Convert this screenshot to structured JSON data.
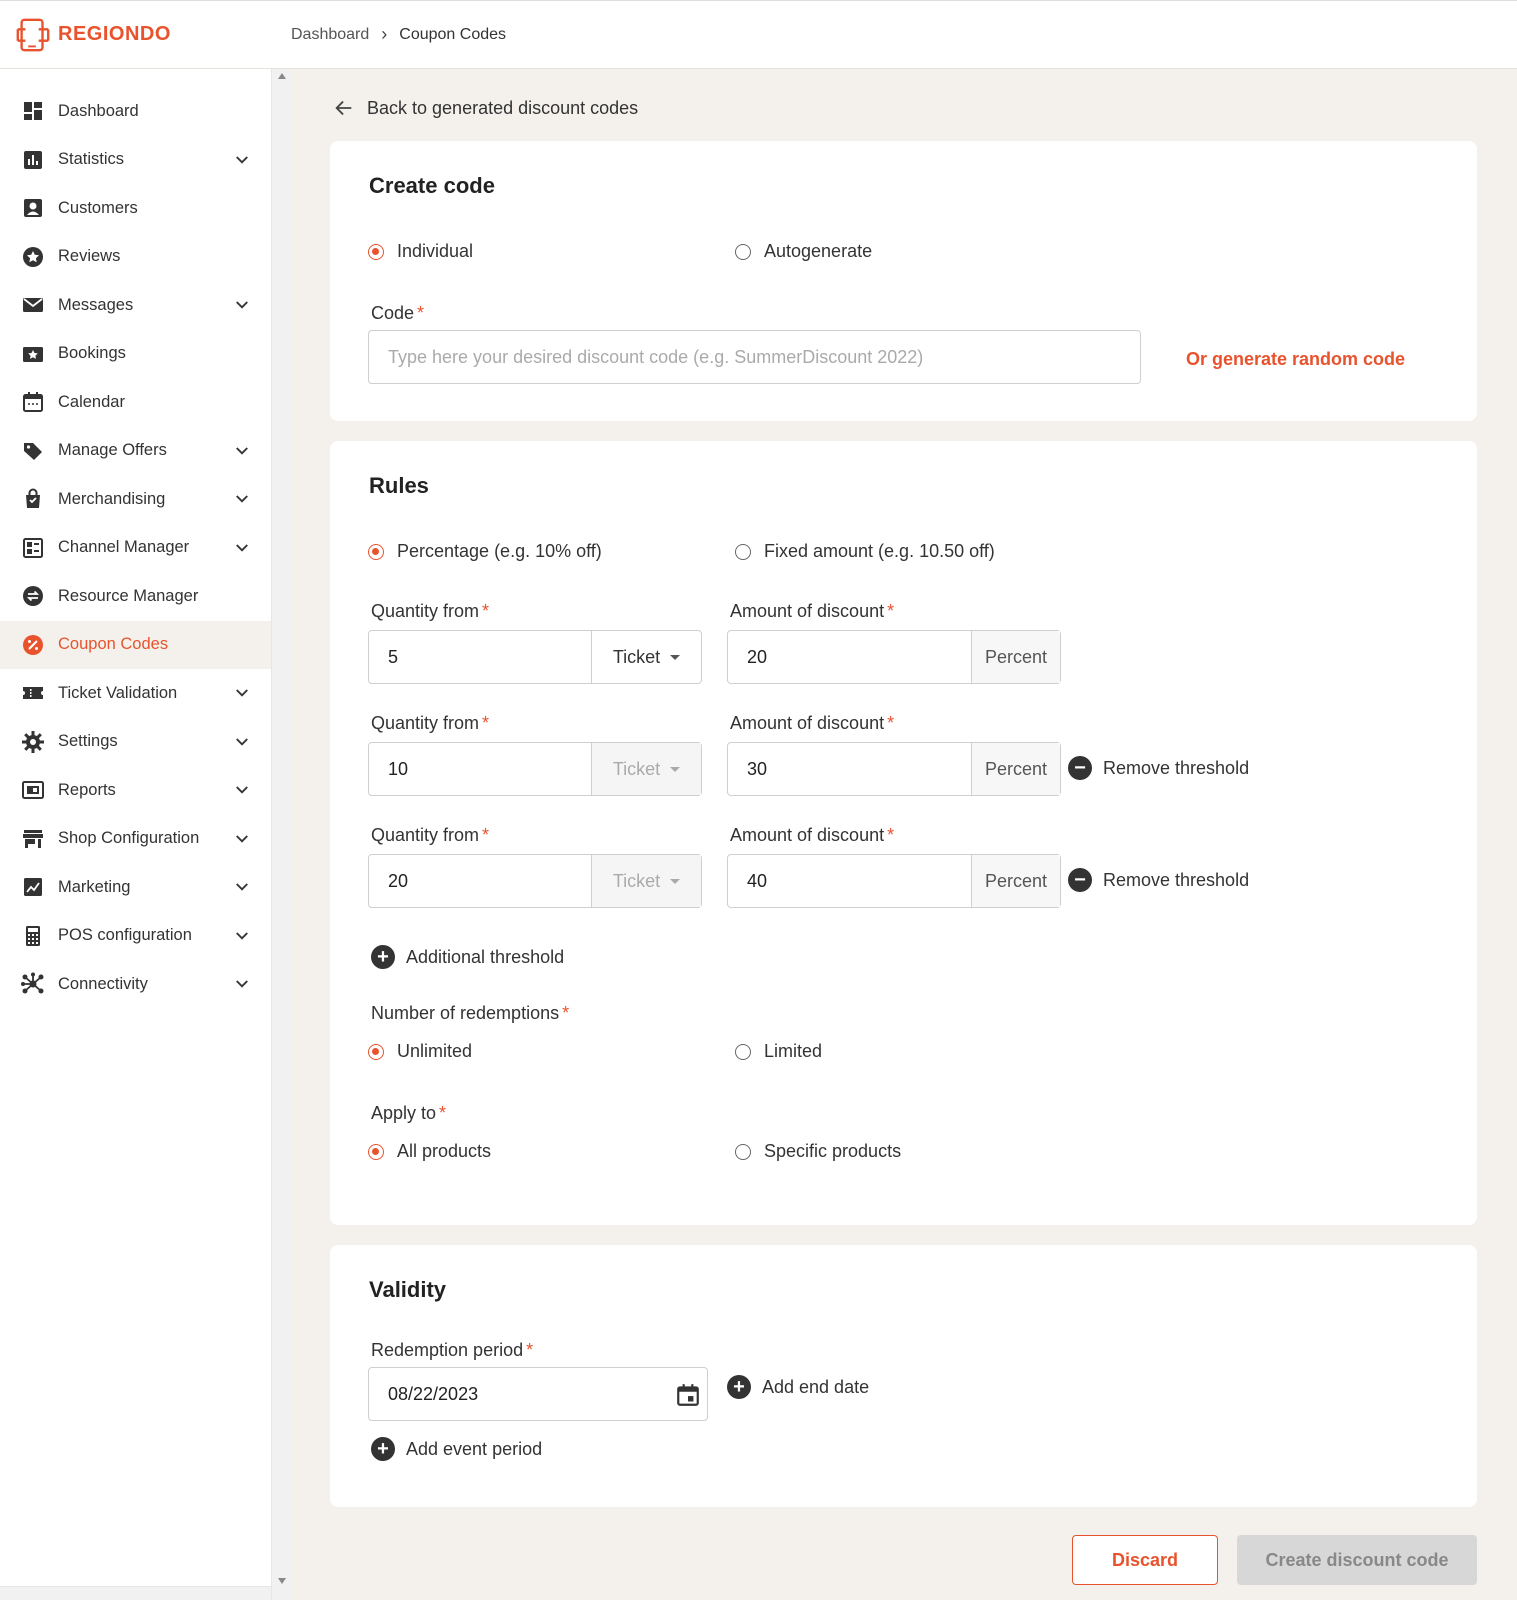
{
  "brand": {
    "name": "REGIONDO",
    "color": "#e8532e"
  },
  "breadcrumb": {
    "items": [
      "Dashboard",
      "Coupon Codes"
    ]
  },
  "sidebar": {
    "items": [
      {
        "label": "Dashboard",
        "icon": "dashboard-icon",
        "expandable": false
      },
      {
        "label": "Statistics",
        "icon": "bar-chart-icon",
        "expandable": true
      },
      {
        "label": "Customers",
        "icon": "person-icon",
        "expandable": false
      },
      {
        "label": "Reviews",
        "icon": "star-icon",
        "expandable": false
      },
      {
        "label": "Messages",
        "icon": "envelope-icon",
        "expandable": true
      },
      {
        "label": "Bookings",
        "icon": "booking-star-icon",
        "expandable": false
      },
      {
        "label": "Calendar",
        "icon": "calendar-icon",
        "expandable": false
      },
      {
        "label": "Manage Offers",
        "icon": "tag-icon",
        "expandable": true
      },
      {
        "label": "Merchandising",
        "icon": "shopping-bag-icon",
        "expandable": true
      },
      {
        "label": "Channel Manager",
        "icon": "channel-icon",
        "expandable": true
      },
      {
        "label": "Resource Manager",
        "icon": "swap-icon",
        "expandable": false
      },
      {
        "label": "Coupon Codes",
        "icon": "percent-icon",
        "expandable": false,
        "active": true
      },
      {
        "label": "Ticket Validation",
        "icon": "ticket-icon",
        "expandable": true
      },
      {
        "label": "Settings",
        "icon": "gear-icon",
        "expandable": true
      },
      {
        "label": "Reports",
        "icon": "report-icon",
        "expandable": true
      },
      {
        "label": "Shop Configuration",
        "icon": "storefront-icon",
        "expandable": true
      },
      {
        "label": "Marketing",
        "icon": "marketing-icon",
        "expandable": true
      },
      {
        "label": "POS configuration",
        "icon": "calculator-icon",
        "expandable": true
      },
      {
        "label": "Connectivity",
        "icon": "hub-icon",
        "expandable": true
      }
    ]
  },
  "back": {
    "label": "Back to generated discount codes"
  },
  "create": {
    "title": "Create code",
    "options": [
      "Individual",
      "Autogenerate"
    ],
    "code_label": "Code",
    "code_placeholder": "Type here your desired discount code (e.g. SummerDiscount 2022)",
    "random_link": "Or generate random code"
  },
  "rules": {
    "title": "Rules",
    "options": [
      "Percentage (e.g. 10% off)",
      "Fixed amount (e.g. 10.50 off)"
    ],
    "qty_label": "Quantity from",
    "amount_label": "Amount of discount",
    "unit_label": "Ticket",
    "percent_label": "Percent",
    "remove_label": "Remove threshold",
    "thresholds": [
      {
        "qty": "5",
        "amount": "20"
      },
      {
        "qty": "10",
        "amount": "30"
      },
      {
        "qty": "20",
        "amount": "40"
      }
    ],
    "add_threshold": "Additional threshold",
    "redemptions_label": "Number of redemptions",
    "redemptions_options": [
      "Unlimited",
      "Limited"
    ],
    "apply_label": "Apply to",
    "apply_options": [
      "All products",
      "Specific products"
    ]
  },
  "validity": {
    "title": "Validity",
    "period_label": "Redemption period",
    "start_date": "08/22/2023",
    "add_end": "Add end date",
    "add_event": "Add event period"
  },
  "actions": {
    "discard": "Discard",
    "create": "Create discount code"
  }
}
